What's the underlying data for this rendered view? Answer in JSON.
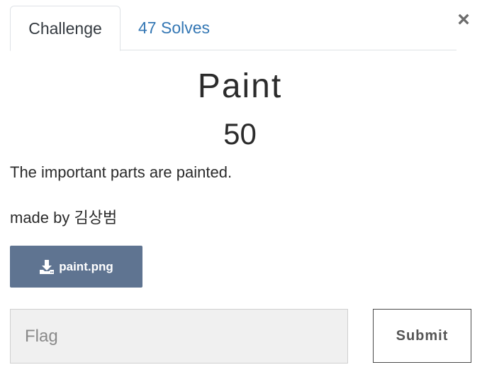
{
  "tabs": {
    "challenge_label": "Challenge",
    "solves_label": "47 Solves"
  },
  "close_label": "×",
  "challenge": {
    "name": "Paint",
    "points": "50",
    "description": "The important parts are painted.",
    "author": "made by 김상범",
    "file_label": "paint.png"
  },
  "flag_form": {
    "placeholder": "Flag",
    "submit_label": "Submit"
  },
  "colors": {
    "accent_link": "#3477b4",
    "file_button": "#5f7491"
  }
}
